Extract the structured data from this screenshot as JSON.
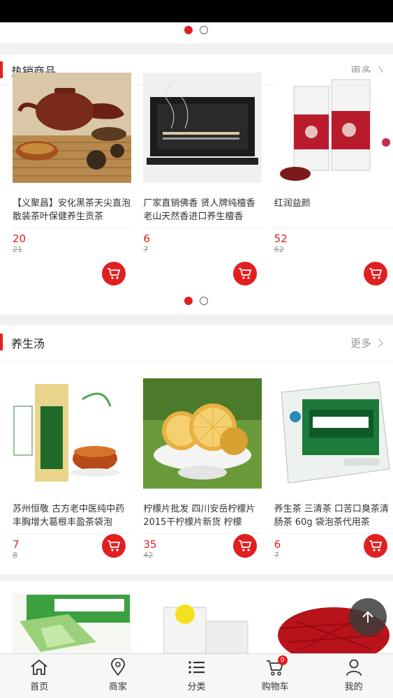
{
  "sections": [
    {
      "title": "热销商品",
      "more": "更多",
      "products": [
        {
          "name": "【义聚昌】安化黑茶天尖直泡散装茶叶保健养生贡茶",
          "price": "20",
          "old_price": "21"
        },
        {
          "name": "厂家直销佛香 贤人牌纯檀香老山天然香进口养生檀香",
          "price": "6",
          "old_price": "7"
        },
        {
          "name": "红润益颜",
          "price": "52",
          "old_price": "62"
        }
      ]
    },
    {
      "title": "养生汤",
      "more": "更多",
      "products": [
        {
          "name": "苏州恒敬 古方老中医纯中药丰胸增大葛根丰盈茶袋泡",
          "price": "7",
          "old_price": "8"
        },
        {
          "name": "柠檬片批发 四川安岳柠檬片 2015干柠檬片新货 柠檬",
          "price": "35",
          "old_price": "42"
        },
        {
          "name": "养生茶 三清茶 口苦口臭茶清肠茶 60g 袋泡茶代用茶",
          "price": "6",
          "old_price": "7"
        }
      ]
    }
  ],
  "tabbar": [
    {
      "label": "首页",
      "icon": "home-icon"
    },
    {
      "label": "商家",
      "icon": "location-pin-icon"
    },
    {
      "label": "分类",
      "icon": "list-icon"
    },
    {
      "label": "购物车",
      "icon": "cart-icon",
      "badge": "0"
    },
    {
      "label": "我的",
      "icon": "person-icon"
    }
  ],
  "colors": {
    "accent": "#e02020"
  }
}
